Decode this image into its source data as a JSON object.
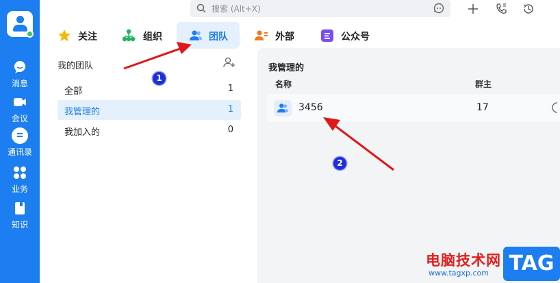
{
  "rail": {
    "items": [
      {
        "label": "消息",
        "icon": "message-icon"
      },
      {
        "label": "会议",
        "icon": "video-icon"
      },
      {
        "label": "通讯录",
        "icon": "contacts-icon"
      },
      {
        "label": "业务",
        "icon": "apps-grid-icon"
      },
      {
        "label": "知识",
        "icon": "book-icon"
      }
    ]
  },
  "search": {
    "placeholder": "搜索 (Alt+X)"
  },
  "tabs": [
    {
      "label": "关注",
      "icon": "star-icon",
      "color": "#f5b800"
    },
    {
      "label": "组织",
      "icon": "org-tree-icon",
      "color": "#19b65a"
    },
    {
      "label": "团队",
      "icon": "team-icon",
      "color": "#1c7ef0"
    },
    {
      "label": "外部",
      "icon": "external-contact-icon",
      "color": "#f07a1c"
    },
    {
      "label": "公众号",
      "icon": "official-account-icon",
      "color": "#7b4cf0"
    }
  ],
  "teams": {
    "title": "我的团队",
    "items": [
      {
        "label": "全部",
        "count": "1"
      },
      {
        "label": "我管理的",
        "count": "1"
      },
      {
        "label": "我加入的",
        "count": "0"
      }
    ]
  },
  "panel": {
    "title": "我管理的",
    "columns": [
      "名称",
      "群主"
    ],
    "rows": [
      {
        "name": "3456",
        "owner": "17"
      }
    ]
  },
  "annotations": {
    "badge1": "1",
    "badge2": "2"
  },
  "watermark": {
    "site": "电脑技术网",
    "url": "www.tagxp.com",
    "tag": "TAG"
  },
  "colors": {
    "accent": "#1c7ef0",
    "arrow": "#e01818"
  }
}
